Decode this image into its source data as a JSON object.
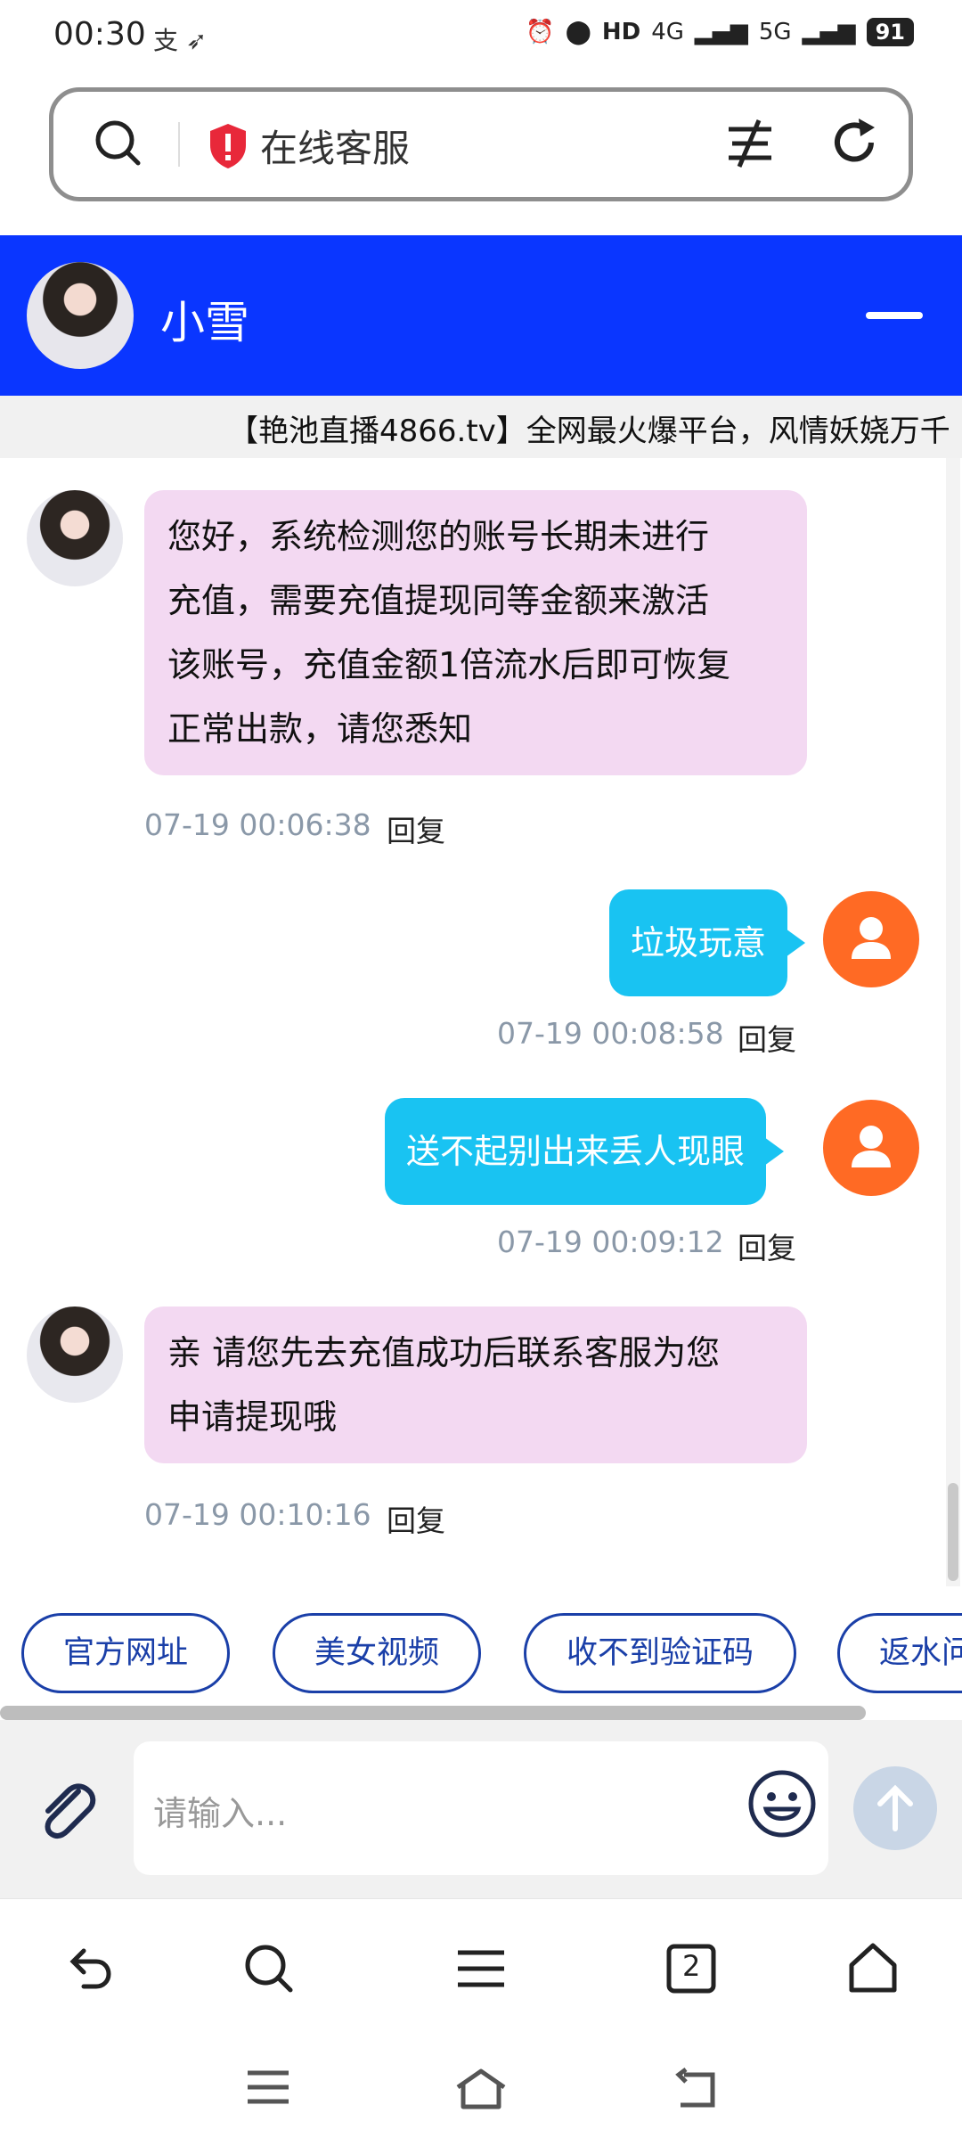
{
  "status_bar": {
    "time": "00:30",
    "network1": "4G",
    "network2": "5G",
    "battery": "91"
  },
  "address_bar": {
    "page_title": "在线客服"
  },
  "chat_header": {
    "agent_name": "小雪"
  },
  "marquee": {
    "text": "【艳池直播4866.tv】全网最火爆平台，风情妖娆万千"
  },
  "messages": [
    {
      "side": "agent",
      "lines": [
        "您好，系统检测您的账号长期未进行",
        "充值，需要充值提现同等金额来激活",
        "该账号，充值金额1倍流水后即可恢复",
        "正常出款，请您悉知"
      ],
      "time": "07-19 00:06:38",
      "reply": "回复"
    },
    {
      "side": "user",
      "text": "垃圾玩意",
      "time": "07-19 00:08:58",
      "reply": "回复"
    },
    {
      "side": "user",
      "text": "送不起别出来丢人现眼",
      "time": "07-19 00:09:12",
      "reply": "回复"
    },
    {
      "side": "agent",
      "lines": [
        "亲 请您先去充值成功后联系客服为您",
        "申请提现哦"
      ],
      "time": "07-19 00:10:16",
      "reply": "回复"
    }
  ],
  "quick_replies": [
    "官方网址",
    "美女视频",
    "收不到验证码",
    "返水问"
  ],
  "input": {
    "placeholder": "请输入..."
  },
  "toolbar": {
    "tab_count": "2"
  },
  "colors": {
    "header_blue": "#0a36ff",
    "agent_bubble": "#f3d9f2",
    "user_bubble": "#19c3f2",
    "user_avatar": "#ff6a24",
    "chip_border": "#1a3fa8"
  }
}
